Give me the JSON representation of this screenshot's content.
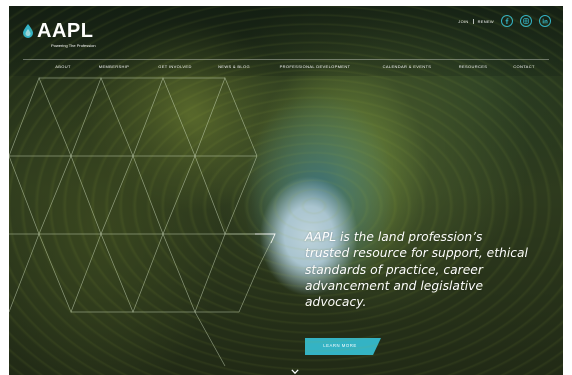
{
  "brand": {
    "name": "AAPL",
    "tagline": "Powering The Profession"
  },
  "utility": {
    "join": "JOIN",
    "renew": "RENEW",
    "social": [
      "facebook-icon",
      "instagram-icon",
      "linkedin-icon"
    ]
  },
  "nav": {
    "items": [
      {
        "label": "ABOUT"
      },
      {
        "label": "MEMBERSHIP"
      },
      {
        "label": "GET INVOLVED"
      },
      {
        "label": "NEWS & BLOG"
      },
      {
        "label": "PROFESSIONAL DEVELOPMENT"
      },
      {
        "label": "CALENDAR & EVENTS"
      },
      {
        "label": "RESOURCES"
      },
      {
        "label": "CONTACT"
      }
    ]
  },
  "hero": {
    "lines": [
      "AAPL is the land profession’s",
      "trusted resource for support, ethical",
      "standards of practice, career",
      "advancement and legislative",
      "advocacy."
    ],
    "cta": "LEARN MORE"
  },
  "colors": {
    "accent": "#34b3c4",
    "text": "#ffffff"
  }
}
